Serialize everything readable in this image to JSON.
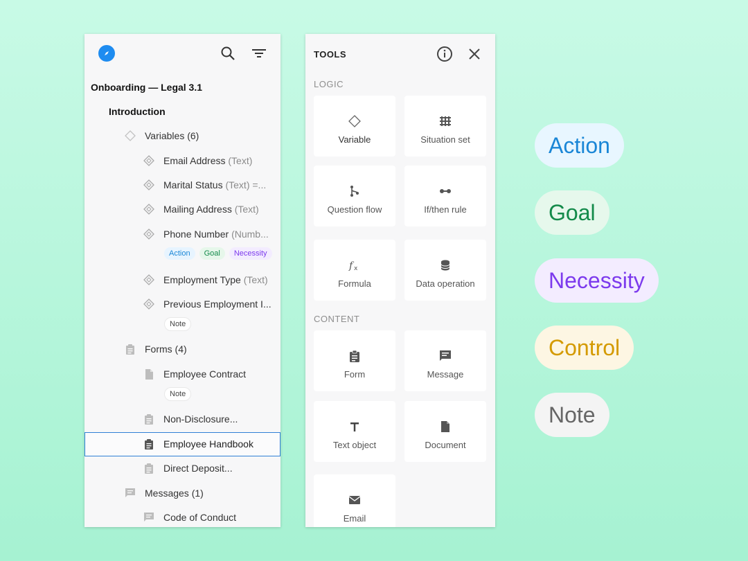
{
  "outline": {
    "project_title": "Onboarding — Legal 3.1",
    "section_title": "Introduction",
    "variables_group": "Variables (6)",
    "variables": [
      {
        "name": "Email Address",
        "type": "(Text)"
      },
      {
        "name": "Marital Status",
        "type": "(Text) =..."
      },
      {
        "name": "Mailing Address",
        "type": "(Text)"
      },
      {
        "name": "Phone Number",
        "type": "(Numb..."
      },
      {
        "name": "Employment Type",
        "type": "(Text)"
      },
      {
        "name": "Previous Employment I...",
        "type": ""
      }
    ],
    "phone_chips": [
      "Action",
      "Goal",
      "Necessity"
    ],
    "note_chip": "Note",
    "forms_group": "Forms (4)",
    "forms": [
      "Employee Contract",
      "Non-Disclosure...",
      "Employee Handbook",
      "Direct Deposit..."
    ],
    "messages_group": "Messages (1)",
    "messages": [
      "Code of Conduct"
    ]
  },
  "tools": {
    "title": "TOOLS",
    "logic_label": "LOGIC",
    "content_label": "CONTENT",
    "logic_items": [
      "Variable",
      "Situation set",
      "Question flow",
      "If/then rule",
      "Formula",
      "Data operation"
    ],
    "content_items": [
      "Form",
      "Message",
      "Text object",
      "Document",
      "Email"
    ]
  },
  "legend": {
    "action": "Action",
    "goal": "Goal",
    "necessity": "Necessity",
    "control": "Control",
    "note": "Note"
  },
  "colors": {
    "action": "#1a86d6",
    "goal": "#138a4a",
    "necessity": "#7c3aed",
    "control": "#d49a00",
    "note": "#666666",
    "selection": "#2f7fd6"
  }
}
